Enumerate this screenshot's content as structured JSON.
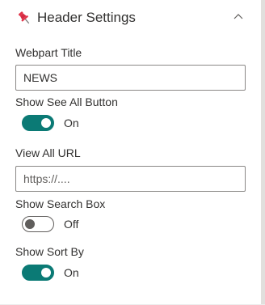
{
  "group": {
    "title": "Header Settings",
    "expanded": true,
    "icon": "pushpin-icon",
    "collapse_icon": "chevron-up-icon"
  },
  "fields": {
    "webpart_title": {
      "label": "Webpart Title",
      "value": "NEWS"
    },
    "show_see_all": {
      "label": "Show See All Button",
      "state_label": "On",
      "checked": true
    },
    "view_all_url": {
      "label": "View All URL",
      "value": "",
      "placeholder": "https://...."
    },
    "show_search": {
      "label": "Show Search Box",
      "state_label": "Off",
      "checked": false
    },
    "show_sort": {
      "label": "Show Sort By",
      "state_label": "On",
      "checked": true
    }
  },
  "colors": {
    "toggle_on": "#0b7a75",
    "pin": "#e0344a",
    "text": "#323130",
    "border": "#8a8886"
  }
}
